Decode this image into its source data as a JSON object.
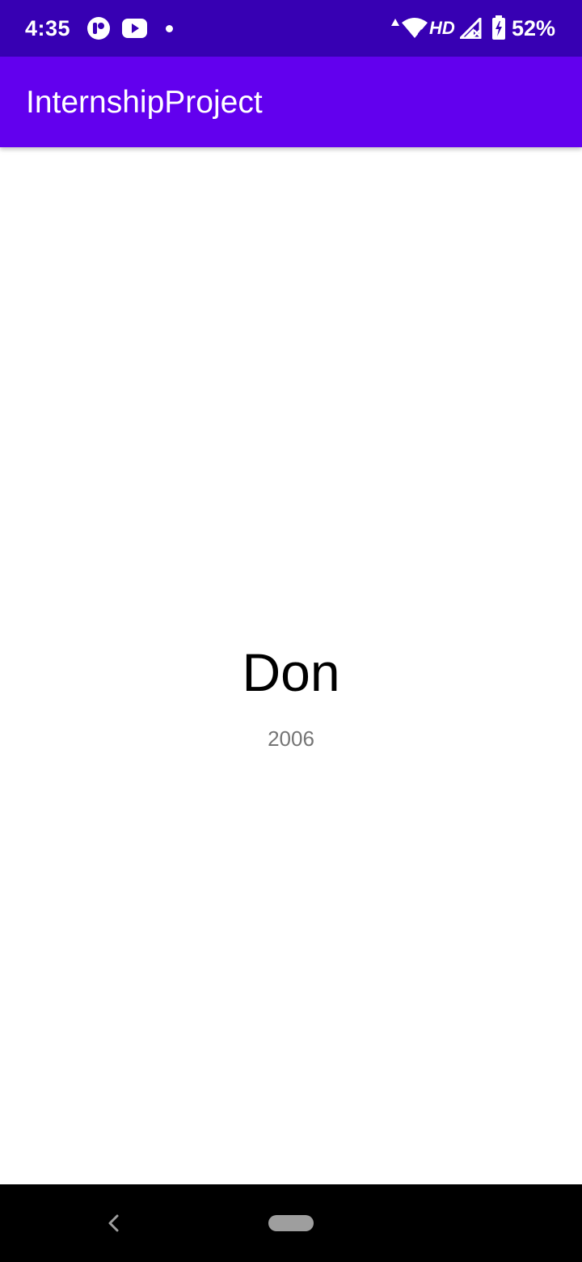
{
  "status_bar": {
    "time": "4:35",
    "network_type": "HD",
    "battery_percent": "52%",
    "background_color": "#3700b3",
    "icons": [
      "notification-app-icon",
      "youtube-icon",
      "notification-dot-icon",
      "data-activity-icon",
      "wifi-icon",
      "signal-icon",
      "battery-charging-icon"
    ]
  },
  "app_bar": {
    "title": "InternshipProject",
    "background_color": "#6200ee"
  },
  "content": {
    "title": "Don",
    "year": "2006"
  },
  "nav_bar": {
    "icons": [
      "back-icon",
      "home-pill-icon"
    ]
  }
}
